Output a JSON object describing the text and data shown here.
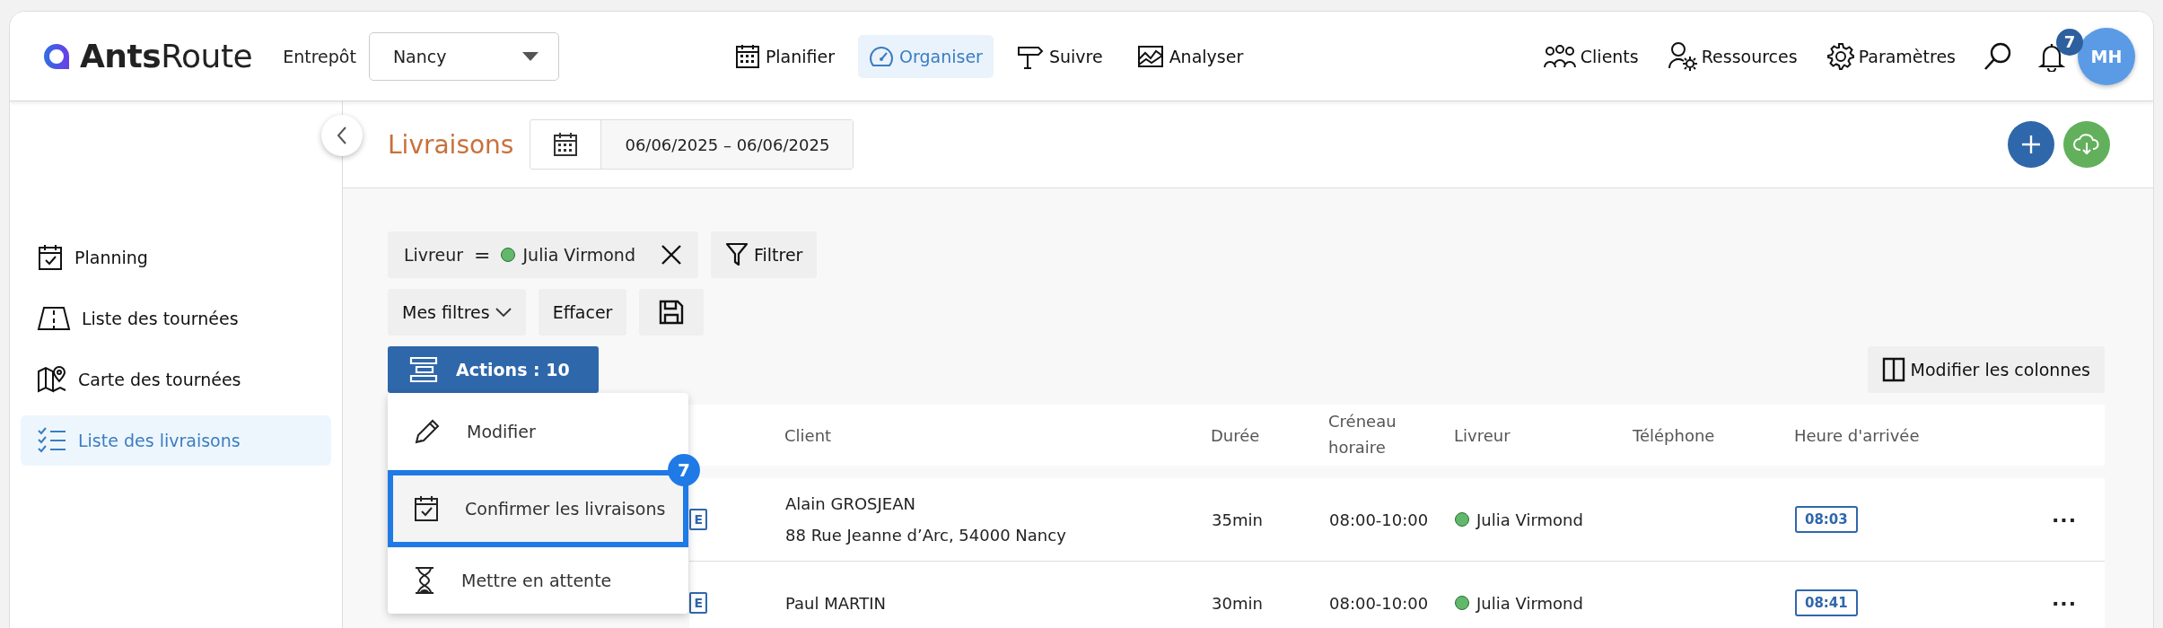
{
  "header": {
    "logo": {
      "bold": "Ants",
      "light": "Route"
    },
    "warehouse_label": "Entrepôt",
    "warehouse_value": "Nancy",
    "nav": [
      {
        "label": "Planifier",
        "selected": false
      },
      {
        "label": "Organiser",
        "selected": true
      },
      {
        "label": "Suivre",
        "selected": false
      },
      {
        "label": "Analyser",
        "selected": false
      }
    ],
    "tools": [
      {
        "label": "Clients"
      },
      {
        "label": "Ressources"
      },
      {
        "label": "Paramètres"
      }
    ],
    "notifications_count": "7",
    "avatar": "MH"
  },
  "sidebar": {
    "items": [
      {
        "label": "Planning",
        "selected": false
      },
      {
        "label": "Liste des tournées",
        "selected": false
      },
      {
        "label": "Carte des tournées",
        "selected": false
      },
      {
        "label": "Liste des livraisons",
        "selected": true
      }
    ]
  },
  "page": {
    "title": "Livraisons",
    "date_range": "06/06/2025 – 06/06/2025"
  },
  "filters": {
    "chip": {
      "field": "Livreur",
      "operator": "=",
      "value": "Julia Virmond"
    },
    "filter_button": "Filtrer",
    "my_filters": "Mes filtres",
    "clear": "Effacer"
  },
  "actions_button": "Actions : 10",
  "columns_button": "Modifier les colonnes",
  "actions_menu": [
    {
      "label": "Modifier",
      "selected": false
    },
    {
      "label": "Confirmer les livraisons",
      "selected": true,
      "badge": "7"
    },
    {
      "label": "Mettre en attente",
      "selected": false
    }
  ],
  "table": {
    "columns": [
      "Client",
      "Durée",
      "Créneau horaire",
      "Livreur",
      "Téléphone",
      "Heure d'arrivée"
    ],
    "rows": [
      {
        "status": "E",
        "client": "Alain GROSJEAN",
        "address": "88 Rue Jeanne d’Arc, 54000 Nancy",
        "duration": "35min",
        "slot": "08:00-10:00",
        "driver": "Julia Virmond",
        "arrival": "08:03",
        "more": "···"
      },
      {
        "status": "E",
        "client": "Paul MARTIN",
        "duration": "30min",
        "slot": "08:00-10:00",
        "driver": "Julia Virmond",
        "arrival": "08:41",
        "more": "···"
      }
    ]
  }
}
